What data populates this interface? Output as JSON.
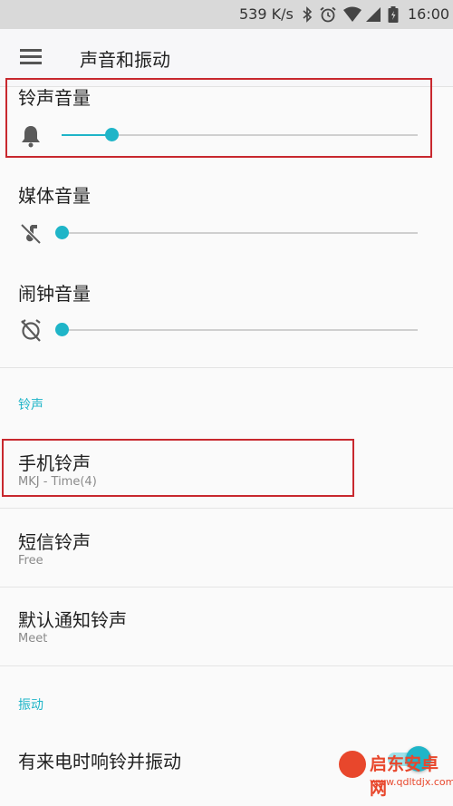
{
  "status_bar": {
    "speed": "539 K/s",
    "time": "16:00",
    "icons": [
      "bluetooth-icon",
      "alarm-icon",
      "wifi-icon",
      "signal-icon",
      "battery-icon"
    ]
  },
  "app_bar": {
    "menu_icon": "menu-icon",
    "title": "声音和振动"
  },
  "volume": {
    "ringtone": {
      "label": "铃声音量",
      "icon": "bell-icon",
      "level": 0.14
    },
    "media": {
      "label": "媒体音量",
      "icon": "music-off-icon",
      "level": 0.0
    },
    "alarm": {
      "label": "闹钟音量",
      "icon": "alarm-off-icon",
      "level": 0.0
    }
  },
  "ringtone_section": {
    "header": "铃声",
    "items": [
      {
        "title": "手机铃声",
        "subtitle": "MKJ - Time(4)"
      },
      {
        "title": "短信铃声",
        "subtitle": "Free"
      },
      {
        "title": "默认通知铃声",
        "subtitle": "Meet"
      }
    ]
  },
  "vibration_section": {
    "header": "振动",
    "items": [
      {
        "title": "有来电时响铃并振动",
        "toggle_on": true
      }
    ]
  },
  "colors": {
    "accent": "#1fb5c8",
    "highlight_box": "#c8282e"
  },
  "watermark": {
    "name": "启东安卓网",
    "url": "www.qdltdjx.com"
  }
}
